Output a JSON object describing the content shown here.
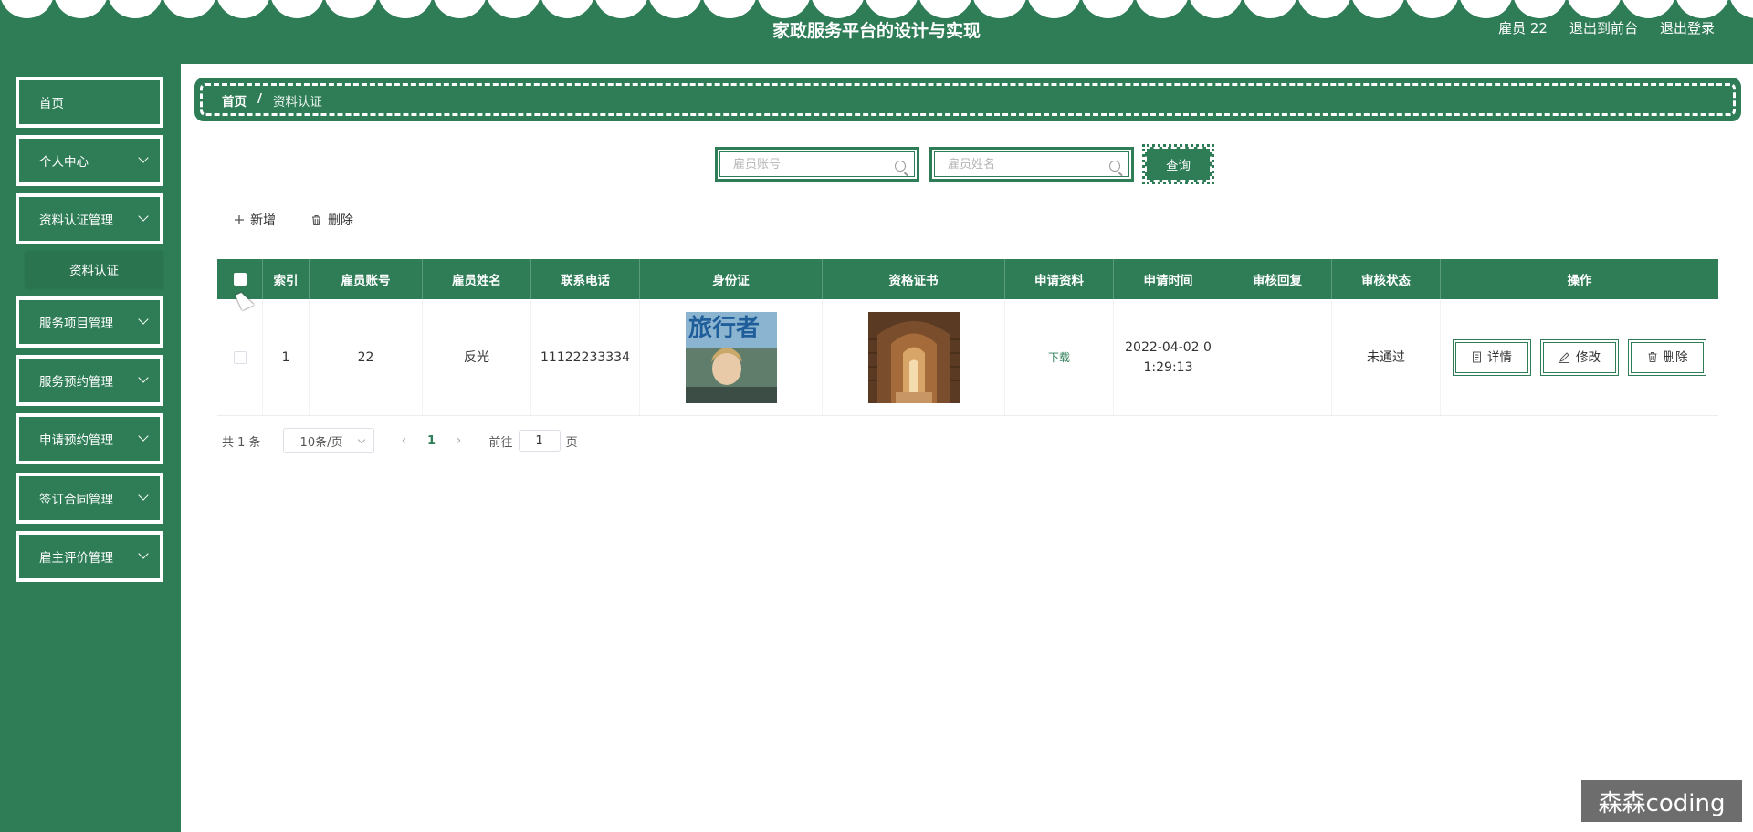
{
  "header": {
    "title": "家政服务平台的设计与实现",
    "user": "雇员 22",
    "front_link": "退出到前台",
    "logout_link": "退出登录"
  },
  "sidebar": {
    "items": [
      {
        "label": "首页",
        "has_arrow": false
      },
      {
        "label": "个人中心",
        "has_arrow": true
      },
      {
        "label": "资料认证管理",
        "has_arrow": true
      },
      {
        "label": "服务项目管理",
        "has_arrow": true
      },
      {
        "label": "服务预约管理",
        "has_arrow": true
      },
      {
        "label": "申请预约管理",
        "has_arrow": true
      },
      {
        "label": "签订合同管理",
        "has_arrow": true
      },
      {
        "label": "雇主评价管理",
        "has_arrow": true
      }
    ],
    "submenu_active": "资料认证"
  },
  "breadcrumb": {
    "home": "首页",
    "separator": "/",
    "current": "资料认证"
  },
  "search": {
    "account_placeholder": "雇员账号",
    "name_placeholder": "雇员姓名",
    "query_label": "查询"
  },
  "toolbar": {
    "add_label": "新增",
    "delete_label": "删除"
  },
  "table": {
    "headers": [
      "索引",
      "雇员账号",
      "雇员姓名",
      "联系电话",
      "身份证",
      "资格证书",
      "申请资料",
      "申请时间",
      "审核回复",
      "审核状态",
      "操作"
    ],
    "rows": [
      {
        "index": "1",
        "account": "22",
        "name": "反光",
        "phone": "11122233334",
        "id_card_image": "magazine-cover",
        "id_card_text": "旅行者",
        "certificate_image": "library-corridor",
        "apply_file": "下载",
        "apply_time_line1": "2022-04-02 0",
        "apply_time_line2": "1:29:13",
        "reply": "",
        "status": "未通过",
        "detail_label": "详情",
        "edit_label": "修改",
        "delete_label": "删除"
      }
    ]
  },
  "pager": {
    "total": "共 1 条",
    "page_size": "10条/页",
    "current_page": "1",
    "goto_prefix": "前往",
    "goto_value": "1",
    "goto_suffix": "页"
  },
  "watermark": "森森coding",
  "colors": {
    "primary": "#2e7d57",
    "white": "#ffffff"
  }
}
